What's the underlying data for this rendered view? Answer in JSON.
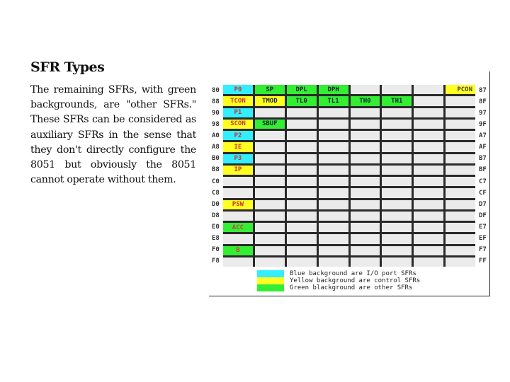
{
  "slide": {
    "title": "SFR Types",
    "body": "The remaining SFRs, with green backgrounds, are \"other SFRs.\" These SFRs can be considered as auxiliary SFRs in the sense that they don't directly configure the 8051 but obviously the 8051 cannot operate without them."
  },
  "colors": {
    "io_port": "#33eeff",
    "control": "#ffff22",
    "other": "#33ee33",
    "empty": "#ebebeb"
  },
  "sfr_map": {
    "row_labels_left": [
      "80",
      "88",
      "90",
      "98",
      "A0",
      "A8",
      "B0",
      "B8",
      "C0",
      "C8",
      "D0",
      "D8",
      "E0",
      "E8",
      "F0",
      "F8"
    ],
    "row_labels_right": [
      "87",
      "8F",
      "97",
      "9F",
      "A7",
      "AF",
      "B7",
      "BF",
      "C7",
      "CF",
      "D7",
      "DF",
      "E7",
      "EF",
      "F7",
      "FF"
    ],
    "rows": [
      [
        {
          "t": "P0",
          "c": "blue"
        },
        {
          "t": "SP",
          "c": "green"
        },
        {
          "t": "DPL",
          "c": "green"
        },
        {
          "t": "DPH",
          "c": "green"
        },
        {
          "t": "",
          "c": ""
        },
        {
          "t": "",
          "c": ""
        },
        {
          "t": "",
          "c": ""
        },
        {
          "t": "PCON",
          "c": "yellow"
        }
      ],
      [
        {
          "t": "TCON",
          "c": "yellow"
        },
        {
          "t": "TMOD",
          "c": "yellow"
        },
        {
          "t": "TL0",
          "c": "green"
        },
        {
          "t": "TL1",
          "c": "green"
        },
        {
          "t": "TH0",
          "c": "green"
        },
        {
          "t": "TH1",
          "c": "green"
        },
        {
          "t": "",
          "c": ""
        },
        {
          "t": "",
          "c": ""
        }
      ],
      [
        {
          "t": "P1",
          "c": "blue"
        },
        {
          "t": "",
          "c": ""
        },
        {
          "t": "",
          "c": ""
        },
        {
          "t": "",
          "c": ""
        },
        {
          "t": "",
          "c": ""
        },
        {
          "t": "",
          "c": ""
        },
        {
          "t": "",
          "c": ""
        },
        {
          "t": "",
          "c": ""
        }
      ],
      [
        {
          "t": "SCON",
          "c": "yellow"
        },
        {
          "t": "SBUF",
          "c": "green"
        },
        {
          "t": "",
          "c": ""
        },
        {
          "t": "",
          "c": ""
        },
        {
          "t": "",
          "c": ""
        },
        {
          "t": "",
          "c": ""
        },
        {
          "t": "",
          "c": ""
        },
        {
          "t": "",
          "c": ""
        }
      ],
      [
        {
          "t": "P2",
          "c": "blue"
        },
        {
          "t": "",
          "c": ""
        },
        {
          "t": "",
          "c": ""
        },
        {
          "t": "",
          "c": ""
        },
        {
          "t": "",
          "c": ""
        },
        {
          "t": "",
          "c": ""
        },
        {
          "t": "",
          "c": ""
        },
        {
          "t": "",
          "c": ""
        }
      ],
      [
        {
          "t": "IE",
          "c": "yellow"
        },
        {
          "t": "",
          "c": ""
        },
        {
          "t": "",
          "c": ""
        },
        {
          "t": "",
          "c": ""
        },
        {
          "t": "",
          "c": ""
        },
        {
          "t": "",
          "c": ""
        },
        {
          "t": "",
          "c": ""
        },
        {
          "t": "",
          "c": ""
        }
      ],
      [
        {
          "t": "P3",
          "c": "blue"
        },
        {
          "t": "",
          "c": ""
        },
        {
          "t": "",
          "c": ""
        },
        {
          "t": "",
          "c": ""
        },
        {
          "t": "",
          "c": ""
        },
        {
          "t": "",
          "c": ""
        },
        {
          "t": "",
          "c": ""
        },
        {
          "t": "",
          "c": ""
        }
      ],
      [
        {
          "t": "IP",
          "c": "yellow"
        },
        {
          "t": "",
          "c": ""
        },
        {
          "t": "",
          "c": ""
        },
        {
          "t": "",
          "c": ""
        },
        {
          "t": "",
          "c": ""
        },
        {
          "t": "",
          "c": ""
        },
        {
          "t": "",
          "c": ""
        },
        {
          "t": "",
          "c": ""
        }
      ],
      [
        {
          "t": "",
          "c": ""
        },
        {
          "t": "",
          "c": ""
        },
        {
          "t": "",
          "c": ""
        },
        {
          "t": "",
          "c": ""
        },
        {
          "t": "",
          "c": ""
        },
        {
          "t": "",
          "c": ""
        },
        {
          "t": "",
          "c": ""
        },
        {
          "t": "",
          "c": ""
        }
      ],
      [
        {
          "t": "",
          "c": ""
        },
        {
          "t": "",
          "c": ""
        },
        {
          "t": "",
          "c": ""
        },
        {
          "t": "",
          "c": ""
        },
        {
          "t": "",
          "c": ""
        },
        {
          "t": "",
          "c": ""
        },
        {
          "t": "",
          "c": ""
        },
        {
          "t": "",
          "c": ""
        }
      ],
      [
        {
          "t": "PSW",
          "c": "yellow"
        },
        {
          "t": "",
          "c": ""
        },
        {
          "t": "",
          "c": ""
        },
        {
          "t": "",
          "c": ""
        },
        {
          "t": "",
          "c": ""
        },
        {
          "t": "",
          "c": ""
        },
        {
          "t": "",
          "c": ""
        },
        {
          "t": "",
          "c": ""
        }
      ],
      [
        {
          "t": "",
          "c": ""
        },
        {
          "t": "",
          "c": ""
        },
        {
          "t": "",
          "c": ""
        },
        {
          "t": "",
          "c": ""
        },
        {
          "t": "",
          "c": ""
        },
        {
          "t": "",
          "c": ""
        },
        {
          "t": "",
          "c": ""
        },
        {
          "t": "",
          "c": ""
        }
      ],
      [
        {
          "t": "ACC",
          "c": "green"
        },
        {
          "t": "",
          "c": ""
        },
        {
          "t": "",
          "c": ""
        },
        {
          "t": "",
          "c": ""
        },
        {
          "t": "",
          "c": ""
        },
        {
          "t": "",
          "c": ""
        },
        {
          "t": "",
          "c": ""
        },
        {
          "t": "",
          "c": ""
        }
      ],
      [
        {
          "t": "",
          "c": ""
        },
        {
          "t": "",
          "c": ""
        },
        {
          "t": "",
          "c": ""
        },
        {
          "t": "",
          "c": ""
        },
        {
          "t": "",
          "c": ""
        },
        {
          "t": "",
          "c": ""
        },
        {
          "t": "",
          "c": ""
        },
        {
          "t": "",
          "c": ""
        }
      ],
      [
        {
          "t": "B",
          "c": "green"
        },
        {
          "t": "",
          "c": ""
        },
        {
          "t": "",
          "c": ""
        },
        {
          "t": "",
          "c": ""
        },
        {
          "t": "",
          "c": ""
        },
        {
          "t": "",
          "c": ""
        },
        {
          "t": "",
          "c": ""
        },
        {
          "t": "",
          "c": ""
        }
      ],
      [
        {
          "t": "",
          "c": ""
        },
        {
          "t": "",
          "c": ""
        },
        {
          "t": "",
          "c": ""
        },
        {
          "t": "",
          "c": ""
        },
        {
          "t": "",
          "c": ""
        },
        {
          "t": "",
          "c": ""
        },
        {
          "t": "",
          "c": ""
        },
        {
          "t": "",
          "c": ""
        }
      ]
    ]
  },
  "legend": [
    {
      "color_key": "io_port",
      "label": "Blue background are I/O port SFRs"
    },
    {
      "color_key": "control",
      "label": "Yellow background are control SFRs"
    },
    {
      "color_key": "other",
      "label": "Green blackground are other SFRs"
    }
  ]
}
